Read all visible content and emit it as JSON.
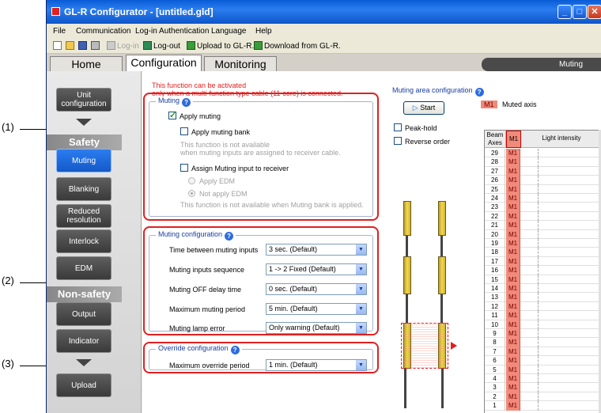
{
  "callouts": [
    {
      "label": "(1)"
    },
    {
      "label": "(2)"
    },
    {
      "label": "(3)"
    }
  ],
  "window": {
    "title": "GL-R Configurator - [untitled.gld]"
  },
  "menu": [
    "File",
    "Communication",
    "Log-in Authentication",
    "Language",
    "Help"
  ],
  "toolbar": {
    "login": "Log-in",
    "logout": "Log-out",
    "upload": "Upload to GL-R.",
    "download": "Download from GL-R."
  },
  "tabs": {
    "home": "Home",
    "configuration": "Configuration",
    "monitoring": "Monitoring",
    "status": "Muting"
  },
  "nav": {
    "unit_configuration": "Unit configuration",
    "safety_header": "Safety",
    "muting": "Muting",
    "blanking": "Blanking",
    "reduced_resolution": "Reduced resolution",
    "interlock": "Interlock",
    "edm": "EDM",
    "nonsafety_header": "Non-safety",
    "output": "Output",
    "indicator": "Indicator",
    "upload": "Upload"
  },
  "notice": {
    "line1": "This function can be activated",
    "line2": "only when a multi-function type cable (11-core) is connected."
  },
  "muting_group": {
    "title": "Muting",
    "apply_muting": "Apply muting",
    "apply_muting_bank": "Apply muting bank",
    "bank_note1": "This function is not available",
    "bank_note2": "when muting inputs are assigned to receiver cable.",
    "assign_input": "Assign Muting input to receiver",
    "apply_edm": "Apply EDM",
    "not_apply_edm": "Not apply EDM",
    "edm_note": "This function is not available when Muting bank is applied."
  },
  "muting_config": {
    "title": "Muting configuration",
    "rows": [
      {
        "label": "Time between muting inputs",
        "value": "3 sec. (Default)"
      },
      {
        "label": "Muting inputs sequence",
        "value": "1 -> 2 Fixed (Default)"
      },
      {
        "label": "Muting OFF delay time",
        "value": "0 sec. (Default)"
      },
      {
        "label": "Maximum muting period",
        "value": "5 min. (Default)"
      },
      {
        "label": "Muting lamp error",
        "value": "Only warning (Default)"
      }
    ]
  },
  "override_config": {
    "title": "Override configuration",
    "label": "Maximum override period",
    "value": "1 min. (Default)"
  },
  "muting_area": {
    "title": "Muting area configuration",
    "start": "Start",
    "legend_tag": "M1",
    "legend_text": "Muted axis",
    "peak_hold": "Peak-hold",
    "reverse_order": "Reverse order"
  },
  "table": {
    "header_axes": "Beam Axes",
    "header_m1": "M1",
    "header_light": "Light intensity",
    "rows": [
      {
        "n": "29",
        "m": "M1"
      },
      {
        "n": "28",
        "m": "M1"
      },
      {
        "n": "27",
        "m": "M1"
      },
      {
        "n": "26",
        "m": "M1"
      },
      {
        "n": "25",
        "m": "M1"
      },
      {
        "n": "24",
        "m": "M1"
      },
      {
        "n": "23",
        "m": "M1"
      },
      {
        "n": "22",
        "m": "M1"
      },
      {
        "n": "21",
        "m": "M1"
      },
      {
        "n": "20",
        "m": "M1"
      },
      {
        "n": "19",
        "m": "M1"
      },
      {
        "n": "18",
        "m": "M1"
      },
      {
        "n": "17",
        "m": "M1"
      },
      {
        "n": "16",
        "m": "M1"
      },
      {
        "n": "15",
        "m": "M1"
      },
      {
        "n": "14",
        "m": "M1"
      },
      {
        "n": "13",
        "m": "M1"
      },
      {
        "n": "12",
        "m": "M1"
      },
      {
        "n": "11",
        "m": "M1"
      },
      {
        "n": "10",
        "m": "M1"
      },
      {
        "n": "9",
        "m": "M1"
      },
      {
        "n": "8",
        "m": "M1"
      },
      {
        "n": "7",
        "m": "M1"
      },
      {
        "n": "6",
        "m": "M1"
      },
      {
        "n": "5",
        "m": "M1"
      },
      {
        "n": "4",
        "m": "M1"
      },
      {
        "n": "3",
        "m": "M1"
      },
      {
        "n": "2",
        "m": "M1"
      },
      {
        "n": "1",
        "m": "M1"
      }
    ]
  },
  "colors": {
    "accent_red": "#e02020",
    "muted_axis": "#f08a7a",
    "nav_active": "#2b7df0"
  }
}
